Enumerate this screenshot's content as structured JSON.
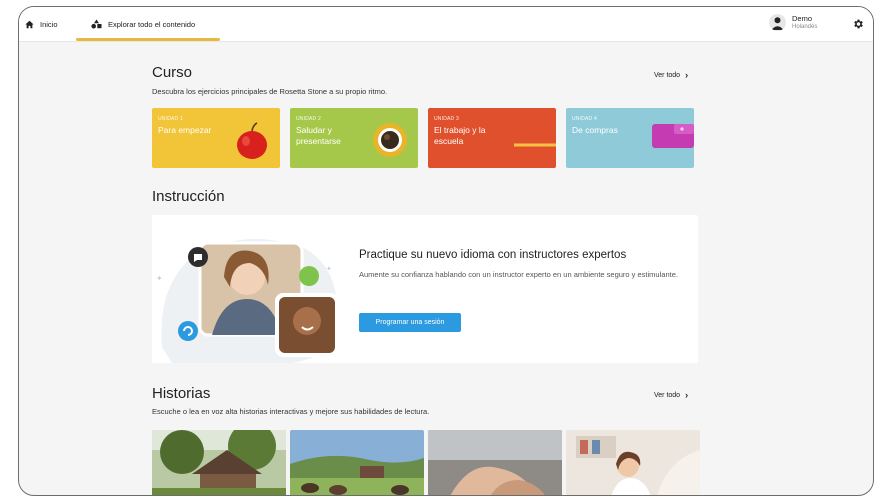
{
  "nav": {
    "home_label": "Inicio",
    "explore_label": "Explorar todo el contenido"
  },
  "user": {
    "name": "Demo",
    "language": "Holandés"
  },
  "course": {
    "title": "Curso",
    "subtitle": "Descubra los ejercicios principales de Rosetta Stone a su propio ritmo.",
    "see_all": "Ver todo",
    "units": [
      {
        "label": "UNIDAD 1",
        "title": "Para empezar",
        "color": "#f2c437"
      },
      {
        "label": "UNIDAD 2",
        "title": "Saludar y presentarse",
        "color": "#a6c84a"
      },
      {
        "label": "UNIDAD 3",
        "title": "El trabajo y la escuela",
        "color": "#e0502d"
      },
      {
        "label": "UNIDAD 4",
        "title": "De compras",
        "color": "#8fcad9"
      }
    ]
  },
  "instruction": {
    "title": "Instrucción",
    "card_title": "Practique su nuevo idioma con instructores expertos",
    "card_desc": "Aumente su confianza hablando con un instructor experto en un ambiente seguro y estimulante.",
    "button_label": "Programar una sesión"
  },
  "stories": {
    "title": "Historias",
    "subtitle": "Escuche o lea en voz alta historias interactivas y mejore sus habilidades de lectura.",
    "see_all": "Ver todo"
  },
  "colors": {
    "accent_underline": "#e9b840",
    "button_blue": "#2b9ae0"
  }
}
